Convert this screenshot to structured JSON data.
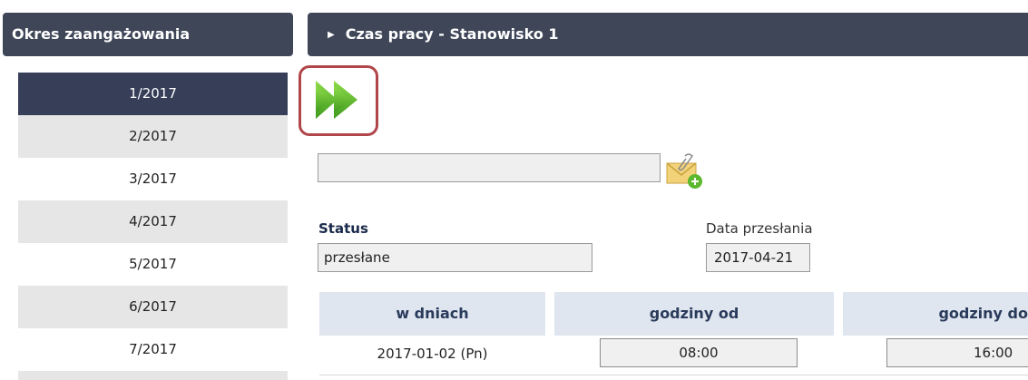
{
  "sidebar": {
    "title": "Okres zaangażowania",
    "periods": [
      "1/2017",
      "2/2017",
      "3/2017",
      "4/2017",
      "5/2017",
      "6/2017",
      "7/2017"
    ]
  },
  "main": {
    "section_title": "Czas pracy - Stanowisko 1",
    "next_icon": "double-arrow-right-icon",
    "attachment_icon": "attachment-add-icon",
    "status_label": "Status",
    "status_value": "przesłane",
    "date_label": "Data przesłania",
    "date_value": "2017-04-21",
    "table": {
      "headers": [
        "w dniach",
        "godziny od",
        "godziny do"
      ],
      "rows": [
        {
          "day": "2017-01-02 (Pn)",
          "from": "08:00",
          "to": "16:00"
        }
      ]
    }
  },
  "colors": {
    "header_bg": "#3e4658",
    "active_period": "#363e58",
    "highlight_border": "#b0464a",
    "arrow_green": "#5cb82e"
  }
}
